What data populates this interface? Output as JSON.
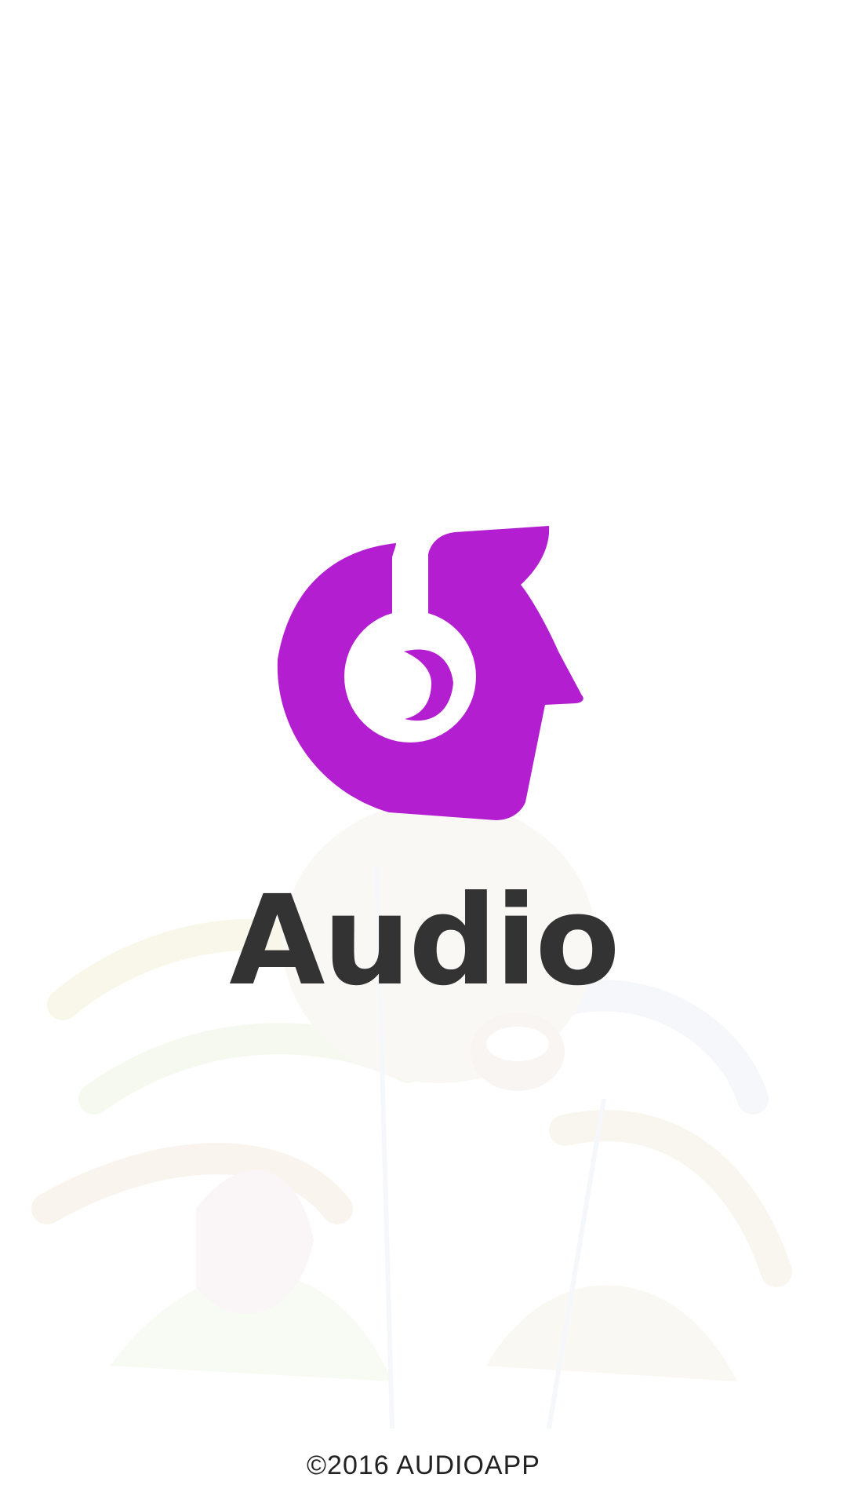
{
  "app": {
    "name": "Audio",
    "copyright": "©2016 AUDIOAPP"
  },
  "logo": {
    "icon": "head-with-headphones-icon",
    "color": "#B31FD0"
  },
  "background": {
    "icon": "screaming-face-art",
    "opacity": 0.5
  },
  "colors": {
    "background": "#FFFFFF",
    "title": "#333333",
    "footer": "#222222"
  }
}
